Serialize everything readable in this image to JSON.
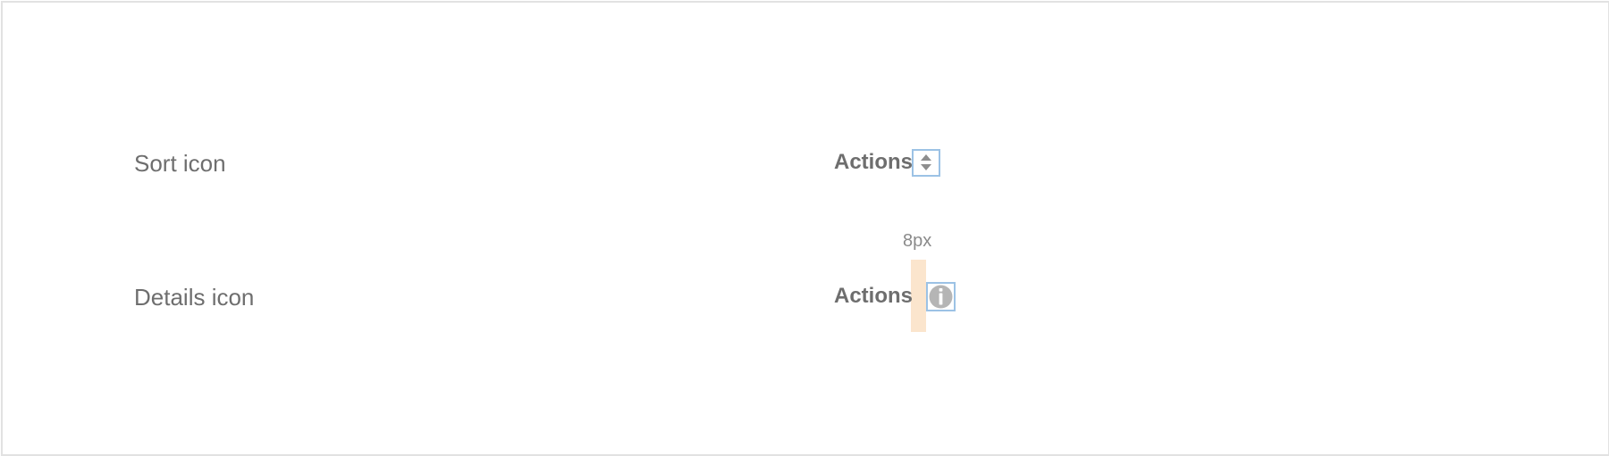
{
  "rows": [
    {
      "label": "Sort icon",
      "header_text": "Actions",
      "icon": "sort-icon"
    },
    {
      "label": "Details icon",
      "header_text": "Actions",
      "icon": "info-icon",
      "spacing_annotation": "8px"
    }
  ],
  "colors": {
    "text": "#6e6e6e",
    "icon_fill": "#8e8e8e",
    "info_icon_fill": "#b5b5b5",
    "outline": "#9cc2e5",
    "gap_highlight": "#fbe5cd",
    "frame_border": "#e2e2e2"
  }
}
